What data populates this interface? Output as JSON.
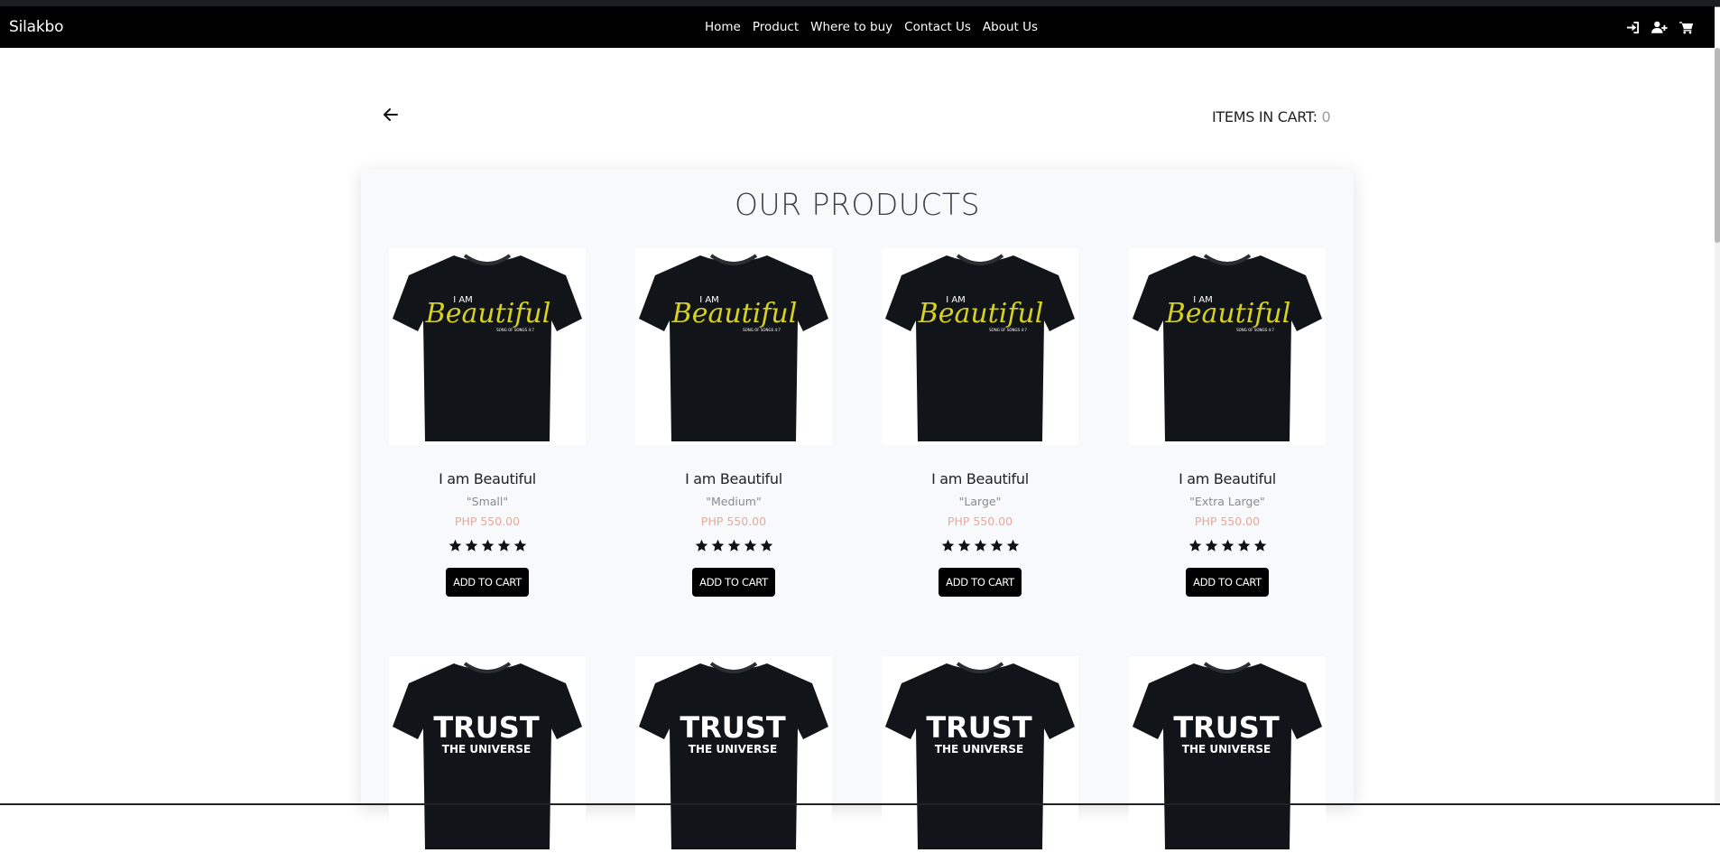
{
  "navbar": {
    "brand": "Silakbo",
    "links": [
      "Home",
      "Product",
      "Where to buy",
      "Contact Us",
      "About Us"
    ],
    "icons": [
      "login-icon",
      "add-user-icon",
      "cart-icon"
    ]
  },
  "cart": {
    "label": "ITEMS IN CART: ",
    "count": "0"
  },
  "section": {
    "title": "OUR PRODUCTS"
  },
  "colors": {
    "navbar": "#000000",
    "price": "#e8a89a",
    "panel": "#f8f9fa",
    "shirt": "#111418",
    "beautiful_text": "#d6d21f"
  },
  "products": [
    {
      "name": "I am Beautiful",
      "size": "\"Small\"",
      "price": "PHP 550.00",
      "rating": 5,
      "button": "ADD TO CART",
      "print": "beautiful"
    },
    {
      "name": "I am Beautiful",
      "size": "\"Medium\"",
      "price": "PHP 550.00",
      "rating": 5,
      "button": "ADD TO CART",
      "print": "beautiful"
    },
    {
      "name": "I am Beautiful",
      "size": "\"Large\"",
      "price": "PHP 550.00",
      "rating": 5,
      "button": "ADD TO CART",
      "print": "beautiful"
    },
    {
      "name": "I am Beautiful",
      "size": "\"Extra Large\"",
      "price": "PHP 550.00",
      "rating": 5,
      "button": "ADD TO CART",
      "print": "beautiful"
    },
    {
      "print": "trust"
    },
    {
      "print": "trust"
    },
    {
      "print": "trust"
    },
    {
      "print": "trust"
    }
  ],
  "shirt_prints": {
    "beautiful": {
      "line1": "I AM",
      "line2": "Beautiful",
      "line3": "SONG OF SONGS 4:7"
    },
    "trust": {
      "line1": "TRUST",
      "line2": "THE UNIVERSE"
    }
  }
}
